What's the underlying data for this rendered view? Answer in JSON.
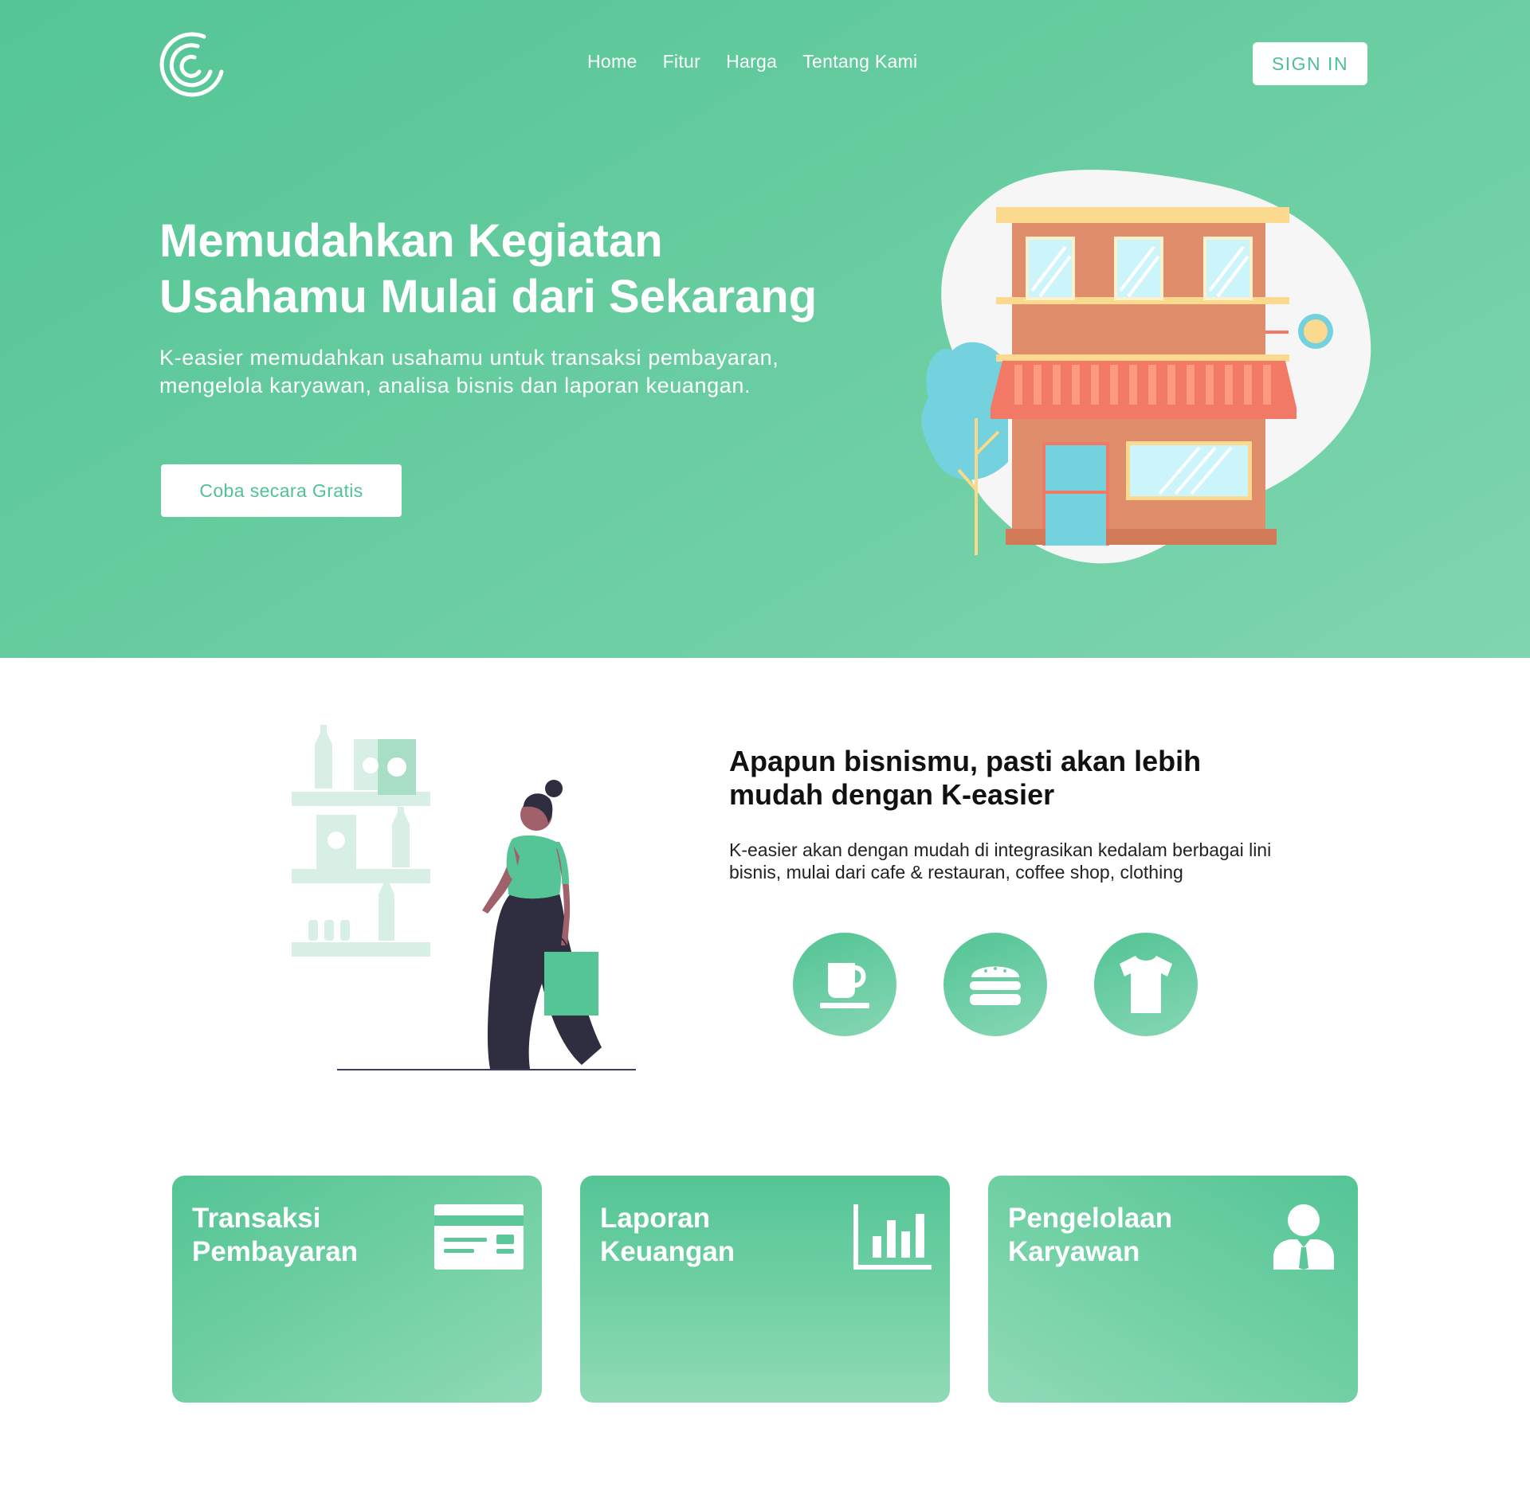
{
  "header": {
    "nav": [
      "Home",
      "Fitur",
      "Harga",
      "Tentang Kami"
    ],
    "signin_label": "SIGN IN"
  },
  "hero": {
    "title_line1": "Memudahkan Kegiatan",
    "title_line2": "Usahamu Mulai dari Sekarang",
    "description": "K-easier memudahkan usahamu untuk transaksi pembayaran, mengelola karyawan, analisa bisnis dan laporan keuangan.",
    "cta_label": "Coba secara Gratis"
  },
  "business": {
    "title": "Apapun bisnismu, pasti akan lebih mudah dengan K-easier",
    "description": "K-easier akan dengan mudah di integrasikan kedalam berbagai lini bisnis, mulai dari cafe & restauran, coffee shop, clothing",
    "icons": [
      "coffee-cup-icon",
      "burger-icon",
      "tshirt-icon"
    ]
  },
  "features": [
    {
      "line1": "Transaksi",
      "line2": "Pembayaran",
      "icon": "credit-card-icon"
    },
    {
      "line1": "Laporan",
      "line2": "Keuangan",
      "icon": "bar-chart-icon"
    },
    {
      "line1": "Pengelolaan",
      "line2": "Karyawan",
      "icon": "employee-icon"
    }
  ],
  "colors": {
    "primary": "#55c596",
    "primary_light": "#86d7b4",
    "white": "#ffffff"
  }
}
